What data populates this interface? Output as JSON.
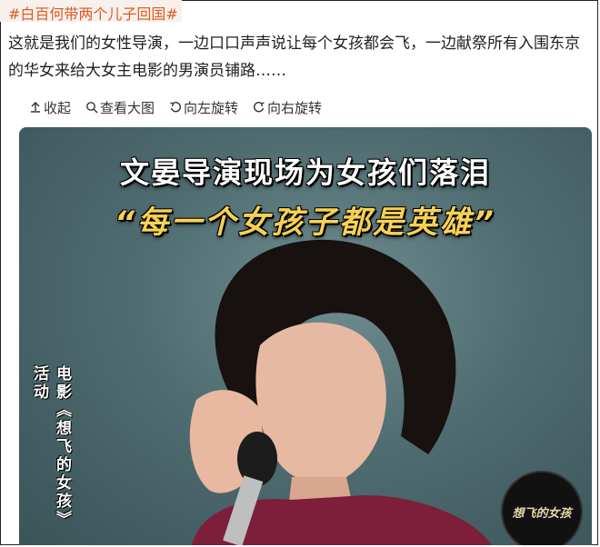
{
  "header": {
    "hashtag": "#白百何带两个儿子回国#"
  },
  "post": {
    "text": "这就是我们的女性导演，一边口口声声说让每个女孩都会飞，一边献祭所有入围东京的华女来给大女主电影的男演员铺路……"
  },
  "toolbar": {
    "collapse_label": "收起",
    "view_large_label": "查看大图",
    "rotate_left_label": "向左旋转",
    "rotate_right_label": "向右旋转"
  },
  "image": {
    "caption_line1": "文晏导演现场为女孩们落泪",
    "caption_line2": "“每一个女孩子都是英雄”",
    "side_text": "电影《想飞的女孩》活动",
    "logo_text": "想飞的女孩",
    "background_color": "#4f6c70",
    "caption_highlight_color": "#f7d154"
  }
}
